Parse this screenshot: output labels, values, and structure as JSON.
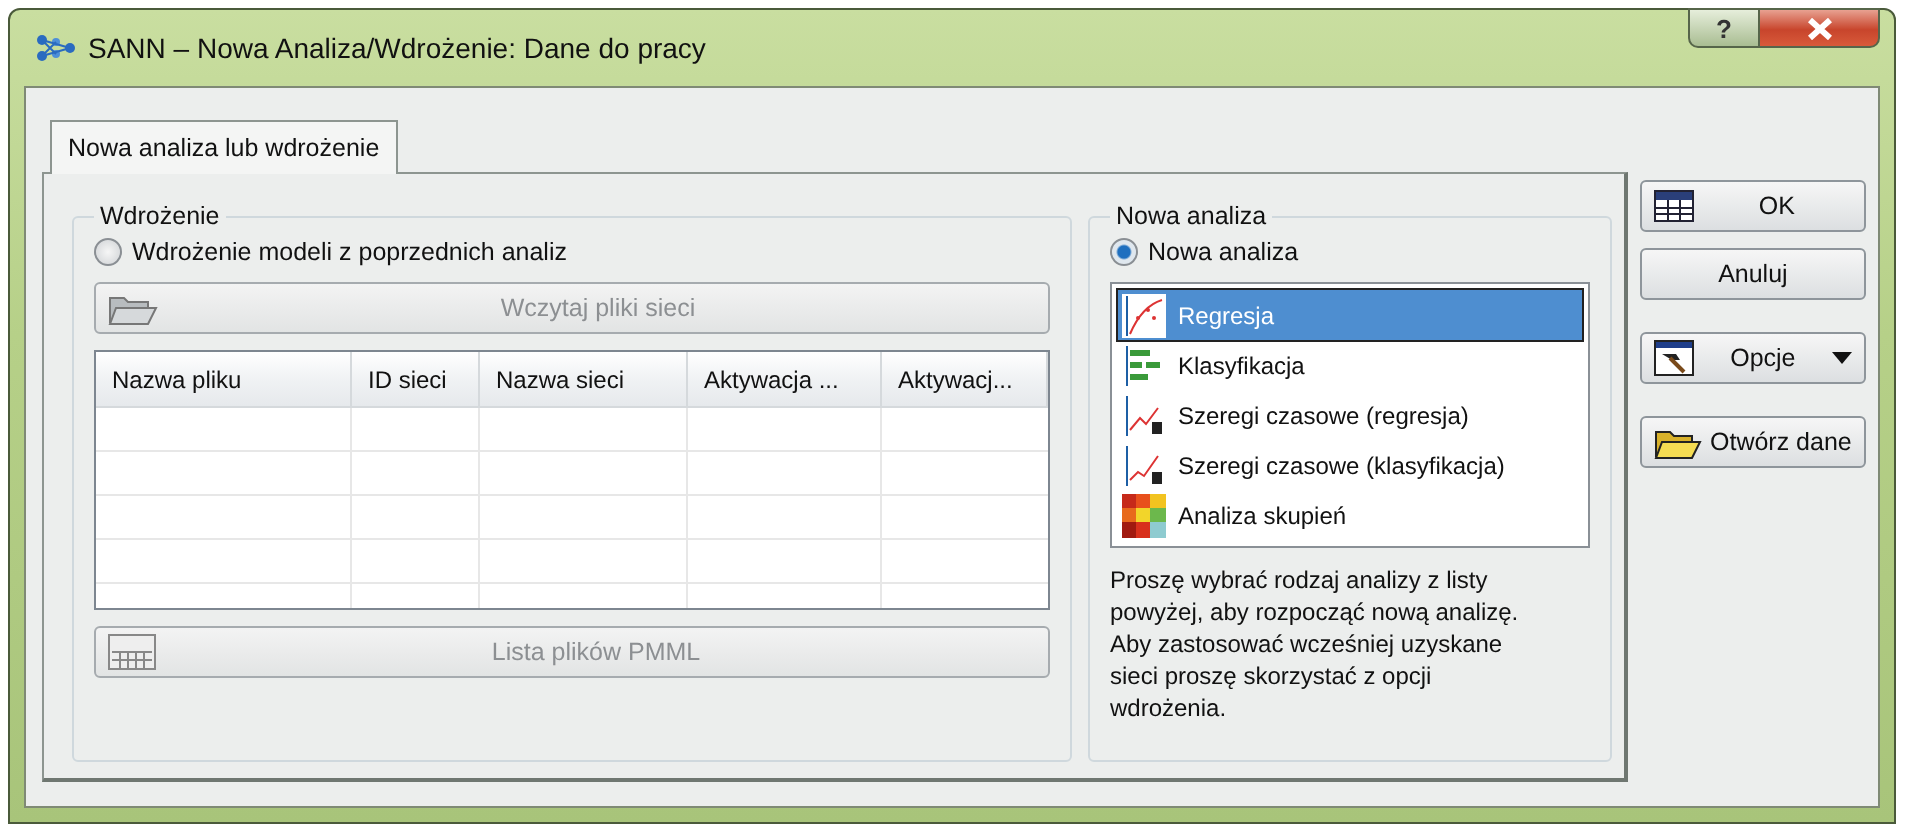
{
  "window": {
    "title": "SANN – Nowa Analiza/Wdrożenie: Dane do pracy",
    "help": "?"
  },
  "tabs": [
    {
      "label": "Nowa analiza lub wdrożenie",
      "selected": true
    }
  ],
  "deployment": {
    "title": "Wdrożenie",
    "radio": {
      "label": "Wdrożenie modeli z poprzednich analiz",
      "selected": false
    },
    "load_button": {
      "label": "Wczytaj pliki sieci",
      "disabled": true
    },
    "table": {
      "columns": [
        "Nazwa pliku",
        "ID sieci",
        "Nazwa sieci",
        "Aktywacja ...",
        "Aktywacj..."
      ]
    },
    "pmml_button": {
      "label": "Lista plików PMML",
      "disabled": true
    }
  },
  "new_analysis": {
    "title": "Nowa analiza",
    "radio": {
      "label": "Nowa analiza",
      "selected": true
    },
    "items": [
      {
        "label": "Regresja",
        "selected": true
      },
      {
        "label": "Klasyfikacja",
        "selected": false
      },
      {
        "label": "Szeregi czasowe (regresja)",
        "selected": false
      },
      {
        "label": "Szeregi czasowe (klasyfikacja)",
        "selected": false
      },
      {
        "label": "Analiza skupień",
        "selected": false
      }
    ],
    "hint": "Proszę wybrać rodzaj analizy z listy powyżej, aby rozpocząć nową analizę. Aby zastosować wcześniej uzyskane sieci proszę skorzystać z opcji wdrożenia."
  },
  "buttons": [
    {
      "label": "OK",
      "kind": "ok"
    },
    {
      "label": "Anuluj",
      "kind": "plain"
    },
    {
      "label": "Opcje",
      "kind": "menu"
    },
    {
      "label": "Otwórz dane",
      "kind": "open"
    }
  ]
}
